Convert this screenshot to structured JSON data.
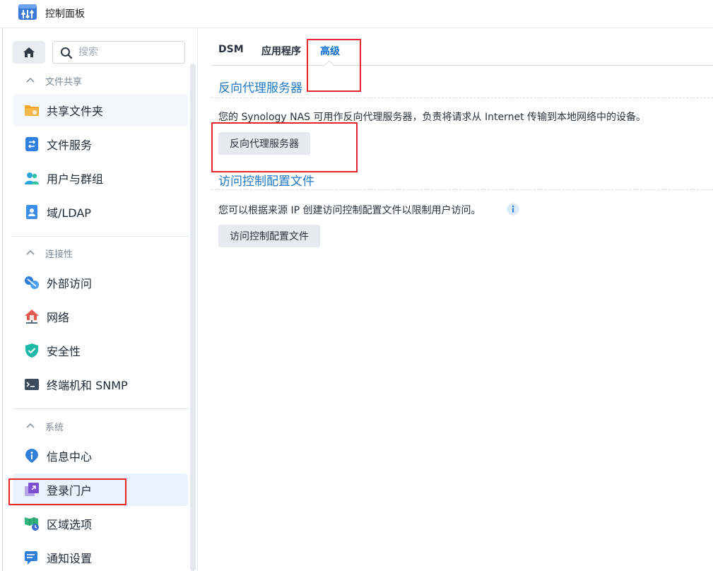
{
  "window": {
    "title": "控制面板"
  },
  "search": {
    "placeholder": "搜索"
  },
  "sidebar": {
    "sections": [
      {
        "title": "文件共享",
        "items": [
          "共享文件夹",
          "文件服务",
          "用户与群组",
          "域/LDAP"
        ]
      },
      {
        "title": "连接性",
        "items": [
          "外部访问",
          "网络",
          "安全性",
          "终端机和 SNMP"
        ]
      },
      {
        "title": "系统",
        "items": [
          "信息中心",
          "登录门户",
          "区域选项",
          "通知设置"
        ]
      }
    ]
  },
  "tabs": {
    "dsm": "DSM",
    "apps": "应用程序",
    "advanced": "高级",
    "active": "高级"
  },
  "reverse_proxy": {
    "title": "反向代理服务器",
    "description": "您的 Synology NAS 可用作反向代理服务器，负责将请求从 Internet 传输到本地网络中的设备。",
    "button": "反向代理服务器"
  },
  "access_control": {
    "title": "访问控制配置文件",
    "description": "您可以根据来源 IP 创建访问控制配置文件以限制用户访问。",
    "button": "访问控制配置文件"
  },
  "colors": {
    "accent": "#0a6fd1",
    "highlight": "#e5262f",
    "active_item_bg": "#e8f1fc"
  }
}
